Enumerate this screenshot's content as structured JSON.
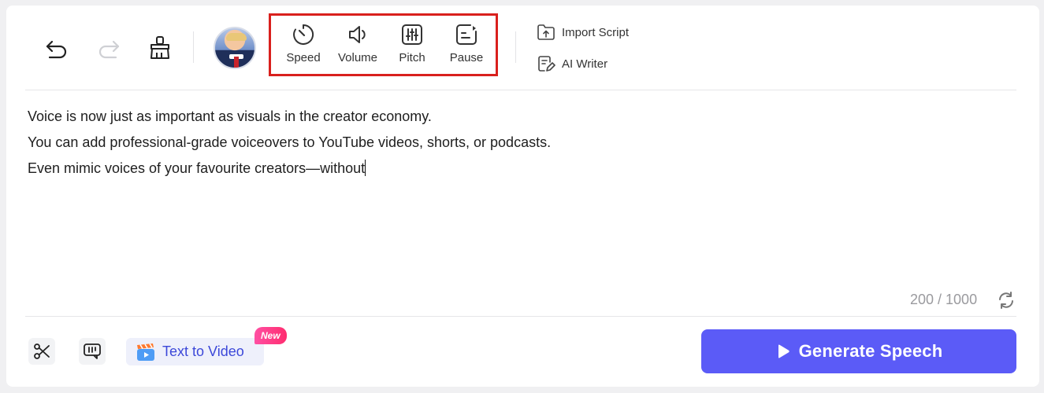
{
  "toolbar": {
    "undo_icon": "undo-icon",
    "redo_icon": "redo-icon",
    "clear_icon": "broom-icon",
    "voice_avatar": "avatar",
    "adjustments": [
      {
        "label": "Speed",
        "icon": "speedometer-icon"
      },
      {
        "label": "Volume",
        "icon": "speaker-icon"
      },
      {
        "label": "Pitch",
        "icon": "sliders-icon"
      },
      {
        "label": "Pause",
        "icon": "pause-insert-icon"
      }
    ],
    "import_script": "Import Script",
    "ai_writer": "AI Writer"
  },
  "editor": {
    "lines": [
      "Voice is now just as important as visuals in the creator economy.",
      "You can add professional-grade voiceovers to YouTube videos, shorts, or podcasts.",
      "Even mimic voices of your favourite creators—without"
    ],
    "counter": "200 / 1000"
  },
  "bottom": {
    "text_to_video": "Text to Video",
    "new_badge": "New",
    "generate": "Generate Speech"
  },
  "colors": {
    "accent": "#5b5bf7",
    "highlight_border": "#d9201d",
    "badge": "#ff2d6f"
  }
}
